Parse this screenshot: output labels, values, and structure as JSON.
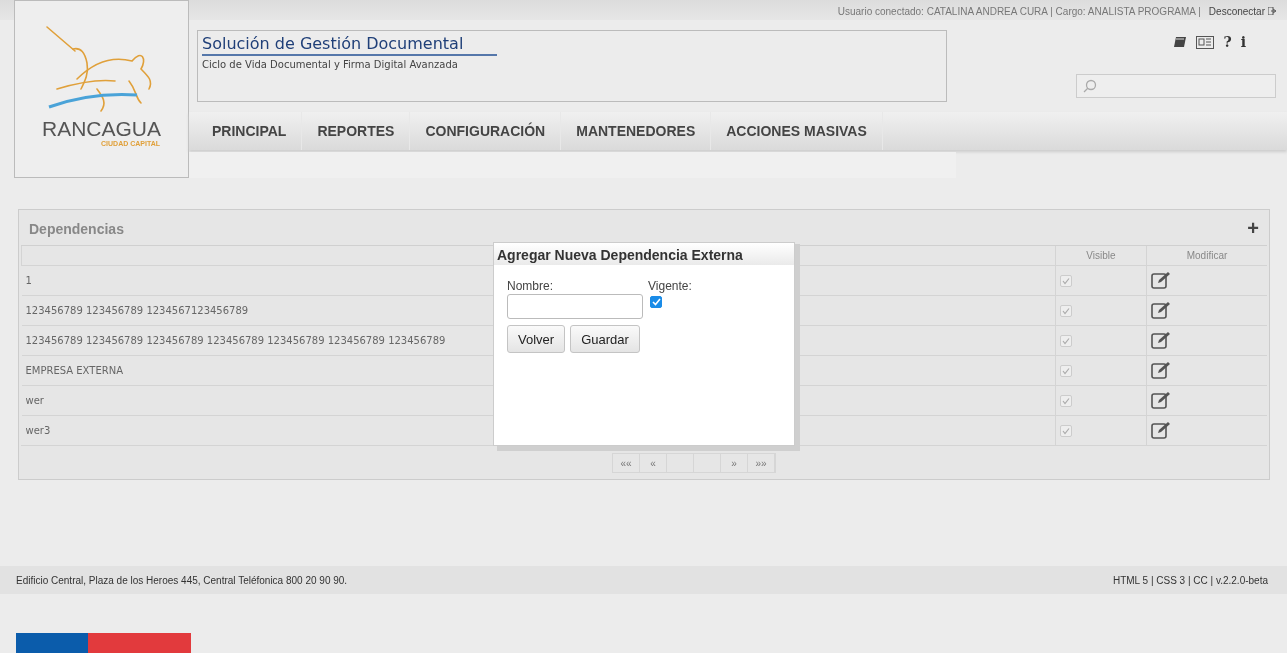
{
  "header": {
    "user_info": "Usuario conectado: CATALINA ANDREA CURA | Cargo: ANALISTA PROGRAMA |",
    "logout": "Desconectar",
    "logo": {
      "name": "RANCAGUA",
      "tagline": "CIUDAD CAPITAL"
    },
    "title": "Solución de Gestión Documental",
    "subtitle": "Ciclo de Vida Documental y Firma Digital Avanzada",
    "help": "?",
    "info": "i"
  },
  "nav": [
    "PRINCIPAL",
    "REPORTES",
    "CONFIGURACIÓN",
    "MANTENEDORES",
    "ACCIONES MASIVAS"
  ],
  "table": {
    "title": "Dependencias",
    "add": "+",
    "columns": [
      "Visible",
      "Modificar"
    ],
    "rows": [
      {
        "name": "1",
        "visible": true
      },
      {
        "name": "123456789 123456789 1234567123456789",
        "visible": true
      },
      {
        "name": "123456789 123456789 123456789 123456789 123456789 123456789 123456789",
        "visible": true
      },
      {
        "name": "EMPRESA EXTERNA",
        "visible": true
      },
      {
        "name": "wer",
        "visible": true
      },
      {
        "name": "wer3",
        "visible": true
      }
    ],
    "pager": {
      "first": "««",
      "prev": "«",
      "next": "»",
      "last": "»»"
    }
  },
  "modal": {
    "title": "Agregar Nueva Dependencia Externa",
    "name_label": "Nombre:",
    "vigente_label": "Vigente:",
    "vigente": true,
    "buttons": [
      "Volver",
      "Guardar"
    ]
  },
  "footer": {
    "address": "Edificio Central, Plaza de los Heroes 445, Central Teléfonica 800 20 90 90.",
    "version": "HTML 5 | CSS 3 | CC | v.2.2.0-beta"
  }
}
